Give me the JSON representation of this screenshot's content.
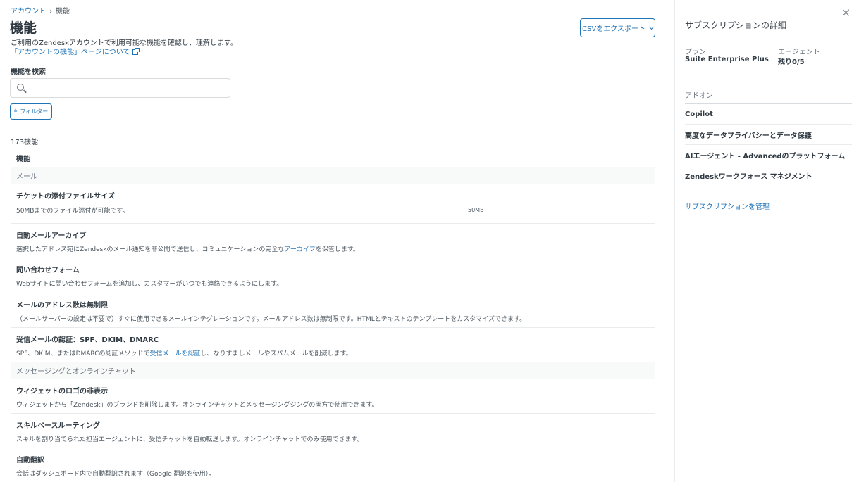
{
  "breadcrumb": {
    "parent": "アカウント",
    "separator": "›",
    "current": "機能"
  },
  "page": {
    "title": "機能",
    "description": "ご利用のZendeskアカウントで利用可能な機能を確認し、理解します。",
    "about_link": "「アカウントの機能」ページについて"
  },
  "export_button": {
    "label": "CSVをエクスポート"
  },
  "search": {
    "label": "機能を検索",
    "value": "",
    "placeholder": ""
  },
  "filter_button": {
    "label": "フィルター"
  },
  "count": "173機能",
  "table": {
    "header": "機能",
    "groups": [
      {
        "name": "メール",
        "rows": [
          {
            "name": "チケットの添付ファイルサイズ",
            "desc": "50MBまでのファイル添付が可能です。",
            "value": "50MB"
          },
          {
            "name": "自動メールアーカイブ",
            "desc_before": "選択したアドレス宛にZendeskのメール通知を非公開で送信し、コミュニケーションの完全な",
            "desc_link": "アーカイブ",
            "desc_after": "を保管します。"
          },
          {
            "name": "問い合わせフォーム",
            "desc": "Webサイトに問い合わせフォームを追加し、カスタマーがいつでも連絡できるようにします。"
          },
          {
            "name": "メールのアドレス数は無制限",
            "desc": "（メールサーバーの設定は不要で）すぐに使用できるメールインテグレーションです。メールアドレス数は無制限です。HTMLとテキストのテンプレートをカスタマイズできます。"
          },
          {
            "name": "受信メールの認証：SPF、DKIM、DMARC",
            "desc_before": "SPF、DKIM、またはDMARCの認証メソッドで",
            "desc_link": "受信メールを認証",
            "desc_after": "し、なりすましメールやスパムメールを削減します。"
          }
        ]
      },
      {
        "name": "メッセージングとオンラインチャット",
        "rows": [
          {
            "name": "ウィジェットのロゴの非表示",
            "desc": "ウィジェットから「Zendesk」のブランドを削除します。オンラインチャットとメッセージングジングの両方で使用できます。"
          },
          {
            "name": "スキルベースルーティング",
            "desc": "スキルを割り当てられた担当エージェントに、受信チャットを自動転送します。オンラインチャットでのみ使用できます。"
          },
          {
            "name": "自動翻訳",
            "desc": "会話はダッシュボード内で自動翻訳されます（Google 翻訳を使用）。"
          }
        ]
      }
    ]
  },
  "sidebar": {
    "title": "サブスクリプションの詳細",
    "plan_label": "プラン",
    "plan_value": "Suite Enterprise Plus",
    "agent_label": "エージェント",
    "agent_value": "残り0/5",
    "addons_label": "アドオン",
    "addons": [
      "Copilot",
      "高度なデータプライバシーとデータ保護",
      "AIエージェント - Advancedのプラットフォーム",
      "Zendeskワークフォース マネジメント"
    ],
    "manage_link": "サブスクリプションを管理"
  }
}
